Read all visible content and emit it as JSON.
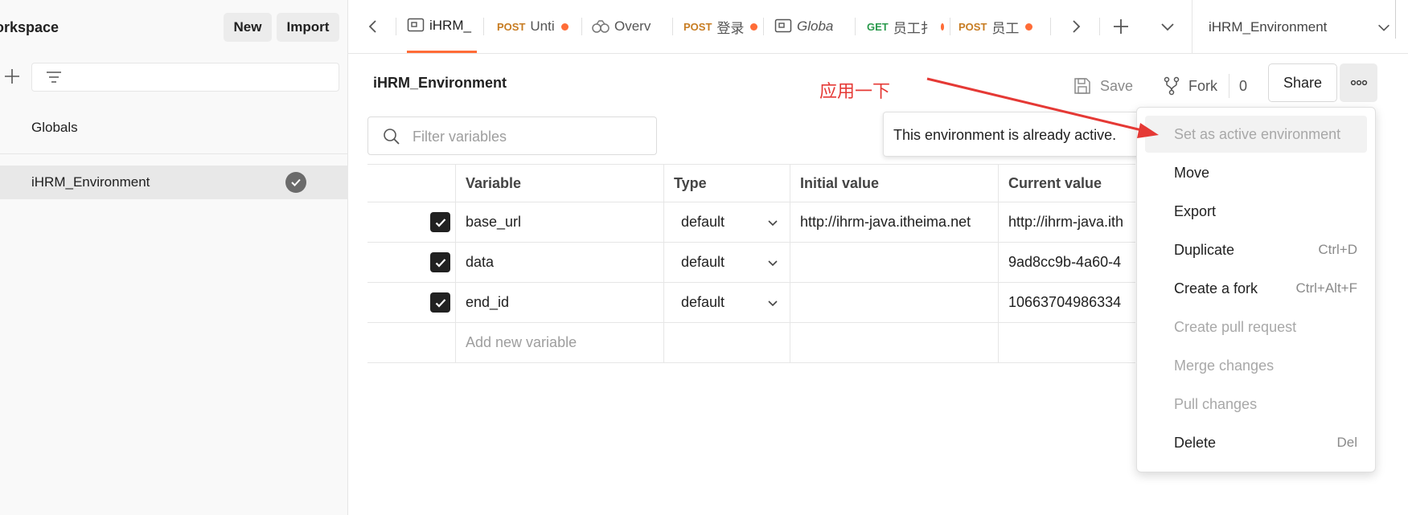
{
  "sidebar": {
    "workspace_title": "orkspace",
    "new_label": "New",
    "import_label": "Import",
    "globals_label": "Globals",
    "env_label": "iHRM_Environment"
  },
  "tabs": [
    {
      "method": "",
      "label": "iHRM_",
      "active": true,
      "dot": false
    },
    {
      "method": "POST",
      "label": "Unti",
      "dot": true
    },
    {
      "method": "",
      "label": "Overv",
      "dot": false
    },
    {
      "method": "POST",
      "label": "登录",
      "dot": true
    },
    {
      "method": "",
      "label": "Globa",
      "dot": false
    },
    {
      "method": "GET",
      "label": "员工扌",
      "dot": true
    },
    {
      "method": "POST",
      "label": "员工",
      "dot": true
    }
  ],
  "env_selector": "iHRM_Environment",
  "main": {
    "title": "iHRM_Environment",
    "save_label": "Save",
    "fork_label": "Fork",
    "fork_count": "0",
    "share_label": "Share",
    "annotation": "应用一下",
    "filter_placeholder": "Filter variables",
    "tooltip": "This environment is already active."
  },
  "table": {
    "headers": [
      "Variable",
      "Type",
      "Initial value",
      "Current value"
    ],
    "rows": [
      {
        "variable": "base_url",
        "type": "default",
        "initial": "http://ihrm-java.itheima.net",
        "current": "http://ihrm-java.ith"
      },
      {
        "variable": "data",
        "type": "default",
        "initial": "",
        "current": "9ad8cc9b-4a60-4"
      },
      {
        "variable": "end_id",
        "type": "default",
        "initial": "",
        "current": "10663704986334"
      }
    ],
    "add_placeholder": "Add new variable"
  },
  "menu": [
    {
      "label": "Set as active environment",
      "shortcut": "",
      "disabled": true,
      "hover": true
    },
    {
      "label": "Move",
      "shortcut": "",
      "disabled": false
    },
    {
      "label": "Export",
      "shortcut": "",
      "disabled": false
    },
    {
      "label": "Duplicate",
      "shortcut": "Ctrl+D",
      "disabled": false
    },
    {
      "label": "Create a fork",
      "shortcut": "Ctrl+Alt+F",
      "disabled": false
    },
    {
      "label": "Create pull request",
      "shortcut": "",
      "disabled": true
    },
    {
      "label": "Merge changes",
      "shortcut": "",
      "disabled": true
    },
    {
      "label": "Pull changes",
      "shortcut": "",
      "disabled": true
    },
    {
      "label": "Delete",
      "shortcut": "Del",
      "disabled": false
    }
  ],
  "colors": {
    "accent": "#ff6c37",
    "annotation": "#e53935",
    "post": "#c77c22",
    "get": "#2a9a4c"
  }
}
